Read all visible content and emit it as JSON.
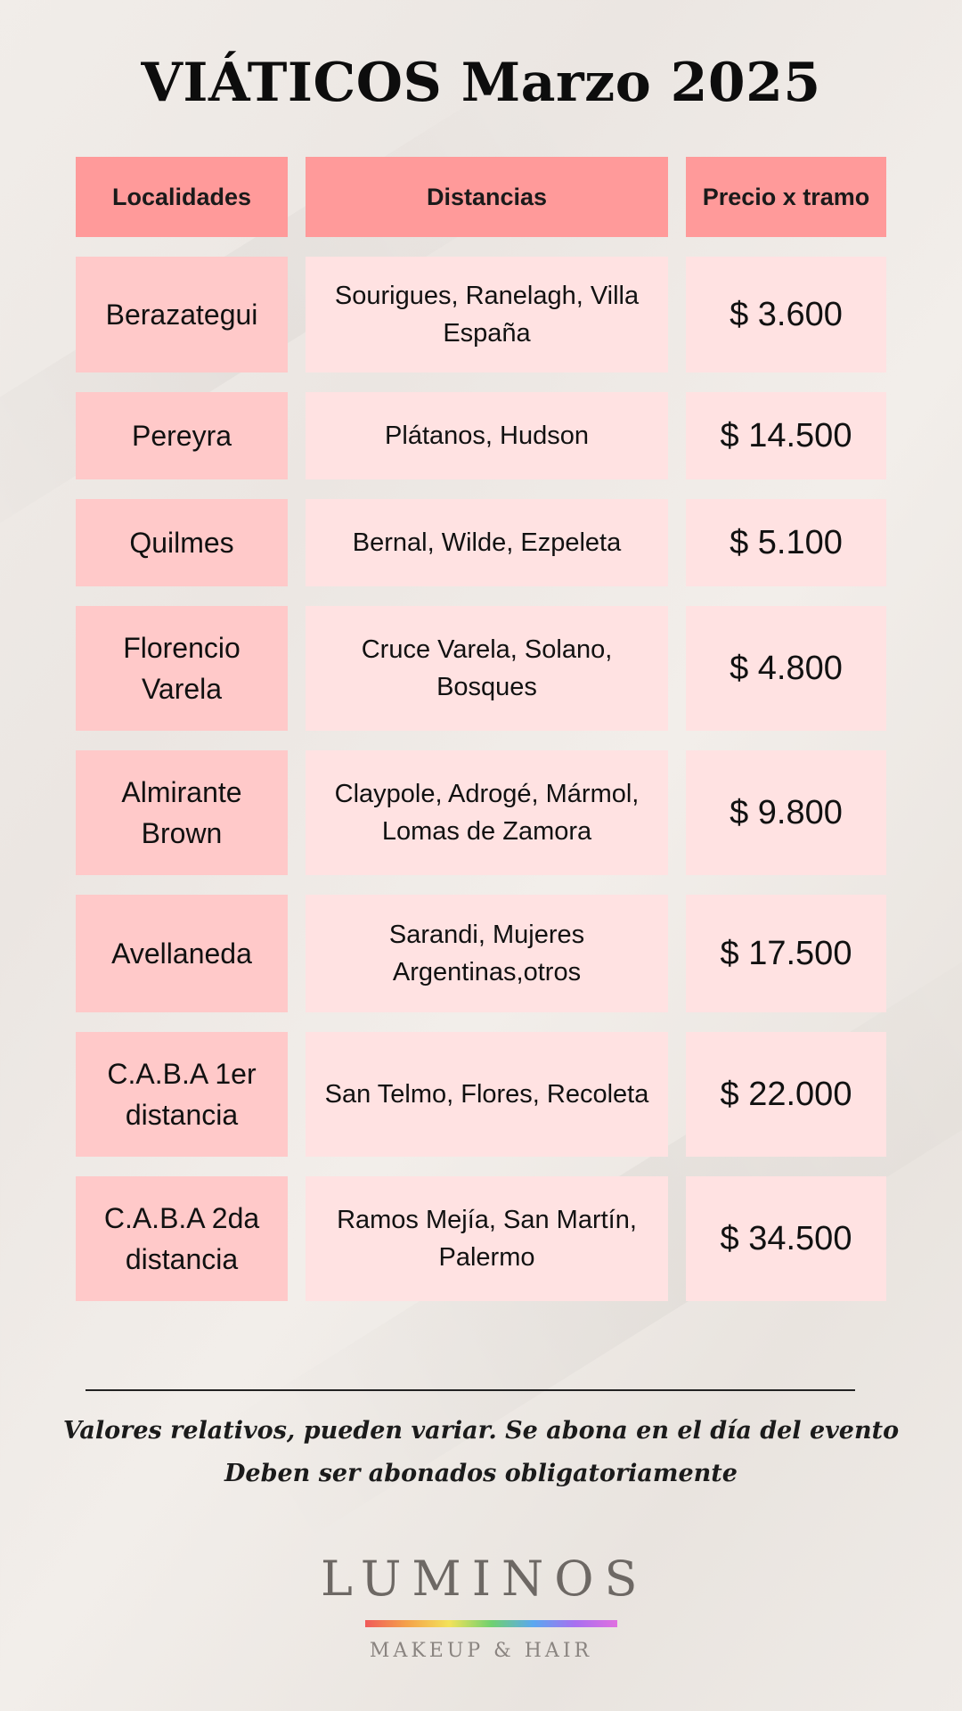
{
  "title": "VIÁTICOS Marzo 2025",
  "table": {
    "headers": [
      "Localidades",
      "Distancias",
      "Precio x tramo"
    ],
    "rows": [
      {
        "localidad": "Berazategui",
        "distancias": "Sourigues, Ranelagh, Villa España",
        "precio": "$ 3.600"
      },
      {
        "localidad": "Pereyra",
        "distancias": "Plátanos, Hudson",
        "precio": "$ 14.500"
      },
      {
        "localidad": "Quilmes",
        "distancias": "Bernal, Wilde, Ezpeleta",
        "precio": "$ 5.100"
      },
      {
        "localidad": "Florencio Varela",
        "distancias": "Cruce Varela, Solano, Bosques",
        "precio": "$ 4.800"
      },
      {
        "localidad": "Almirante Brown",
        "distancias": "Claypole, Adrogé, Mármol, Lomas de Zamora",
        "precio": "$ 9.800"
      },
      {
        "localidad": "Avellaneda",
        "distancias": "Sarandi, Mujeres Argentinas,otros",
        "precio": "$ 17.500"
      },
      {
        "localidad": "C.A.B.A 1er distancia",
        "distancias": "San Telmo, Flores, Recoleta",
        "precio": "$ 22.000"
      },
      {
        "localidad": "C.A.B.A 2da distancia",
        "distancias": "Ramos Mejía, San Martín, Palermo",
        "precio": "$ 34.500"
      }
    ]
  },
  "footer": {
    "note_line1": "Valores relativos, pueden variar. Se abona en el día del evento",
    "note_line2": "Deben ser abonados obligatoriamente"
  },
  "logo": {
    "brand": "LUMINOS",
    "tagline": "MAKEUP & HAIR"
  },
  "colors": {
    "header_bg": "#ff9a9a",
    "localidad_bg": "#ffc9c9",
    "cell_bg": "#ffe2e2",
    "page_bg": "#efebe7"
  }
}
